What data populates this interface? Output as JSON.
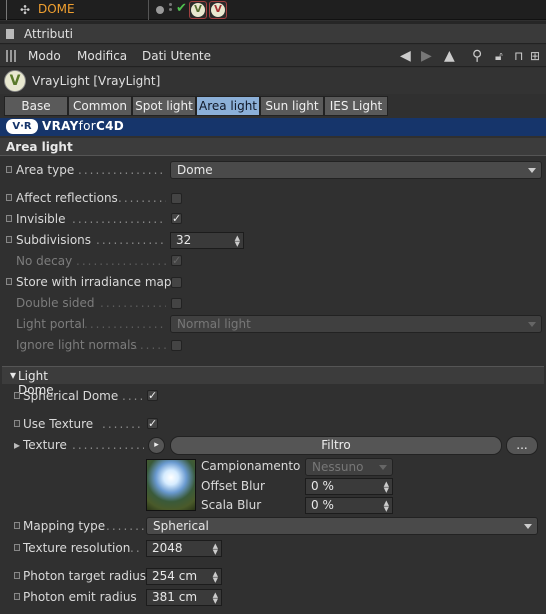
{
  "object_manager": {
    "object_name": "DOME"
  },
  "attributes_panel": {
    "title": "Attributi",
    "menu": [
      "Modo",
      "Modifica",
      "Dati Utente"
    ]
  },
  "object": {
    "title": "VrayLight [VrayLight]"
  },
  "tabs": [
    {
      "label": "Base",
      "active": false
    },
    {
      "label": "Common",
      "active": false
    },
    {
      "label": "Spot light",
      "active": false
    },
    {
      "label": "Area light",
      "active": true
    },
    {
      "label": "Sun light",
      "active": false
    },
    {
      "label": "IES Light",
      "active": false
    }
  ],
  "banner": {
    "logo": "V·R",
    "text_bold": "VRAY",
    "text_light": "for",
    "text_tail": "C4D"
  },
  "area_light": {
    "section_title": "Area light",
    "area_type": {
      "label": "Area type",
      "value": "Dome"
    },
    "affect_reflections": {
      "label": "Affect reflections",
      "checked": false
    },
    "invisible": {
      "label": "Invisible",
      "checked": true
    },
    "subdivisions": {
      "label": "Subdivisions",
      "value": "32"
    },
    "no_decay": {
      "label": "No decay",
      "checked": true,
      "enabled": false
    },
    "store_irradiance": {
      "label": "Store with irradiance map",
      "checked": false
    },
    "double_sided": {
      "label": "Double sided",
      "checked": false,
      "enabled": false
    },
    "light_portal": {
      "label": "Light portal",
      "value": "Normal light",
      "enabled": false
    },
    "ignore_light_normals": {
      "label": "Ignore light normals",
      "checked": false,
      "enabled": false
    }
  },
  "light_dome": {
    "section_title": "Light Dome",
    "spherical_dome": {
      "label": "Spherical Dome",
      "checked": true
    },
    "use_texture": {
      "label": "Use Texture",
      "checked": true
    },
    "texture": {
      "label": "Texture",
      "button": "Filtro",
      "more_button": "..."
    },
    "campionamento": {
      "label": "Campionamento",
      "value": "Nessuno"
    },
    "offset_blur": {
      "label": "Offset Blur",
      "value": "0 %"
    },
    "scala_blur": {
      "label": "Scala Blur",
      "value": "0 %"
    },
    "mapping_type": {
      "label": "Mapping type",
      "value": "Spherical"
    },
    "texture_resolution": {
      "label": "Texture resolution",
      "value": "2048"
    },
    "photon_target_radius": {
      "label": "Photon target radius",
      "value": "254 cm"
    },
    "photon_emit_radius": {
      "label": "Photon emit radius",
      "value": "381 cm"
    }
  },
  "colors": {
    "background": "#303030",
    "active_tab": "#8cb0d8",
    "banner": "#16356b",
    "object_name": "#f0a030"
  }
}
